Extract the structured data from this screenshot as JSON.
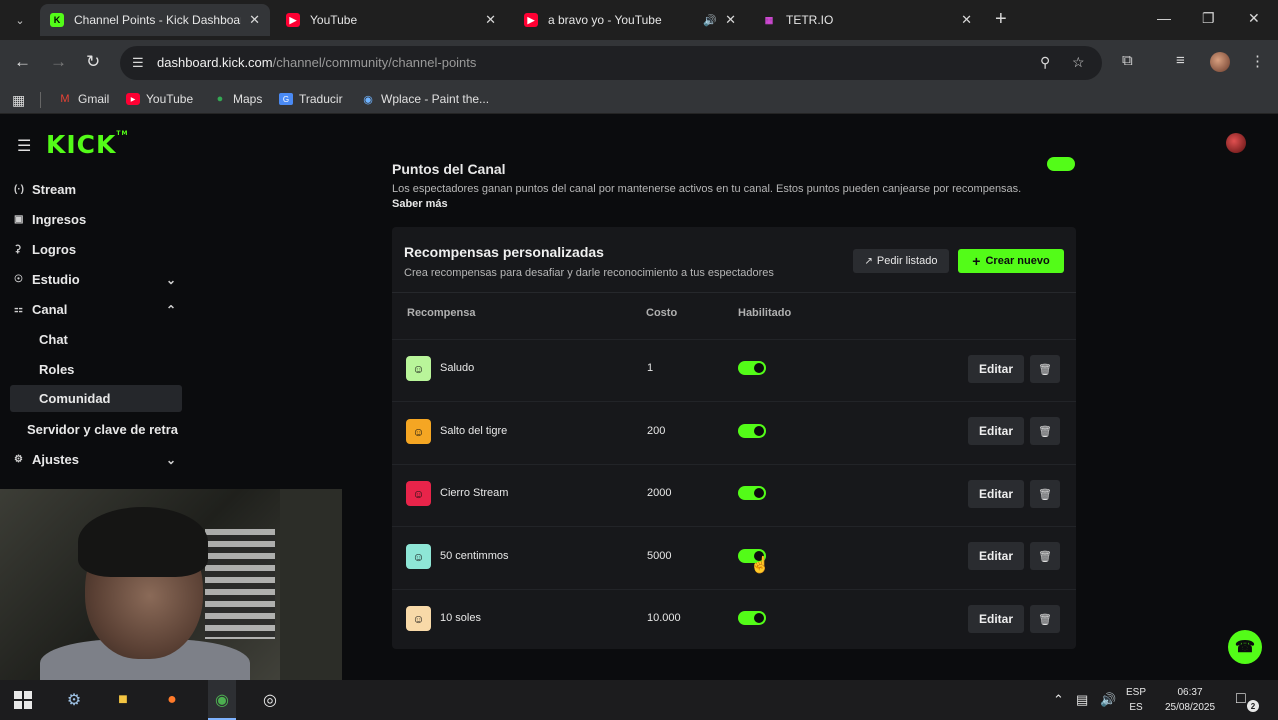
{
  "browser": {
    "tabs": [
      {
        "title": "Channel Points - Kick Dashboard",
        "favicon": "kick-icon",
        "active": true
      },
      {
        "title": "YouTube",
        "favicon": "youtube-icon",
        "active": false
      },
      {
        "title": "a bravo yo - YouTube",
        "favicon": "youtube-icon",
        "active": false,
        "audio": true
      },
      {
        "title": "TETR.IO",
        "favicon": "tetrio-icon",
        "active": false
      }
    ],
    "url_host": "dashboard.kick.com",
    "url_path": "/channel/community/channel-points",
    "bookmarks": [
      "Gmail",
      "YouTube",
      "Maps",
      "Traducir",
      "Wplace - Paint the..."
    ]
  },
  "sidebar": {
    "logo": "KICK",
    "logo_tm": "TM",
    "items": [
      {
        "label": "Stream",
        "icon": "broadcast-icon"
      },
      {
        "label": "Ingresos",
        "icon": "wallet-icon"
      },
      {
        "label": "Logros",
        "icon": "trophy-icon"
      },
      {
        "label": "Estudio",
        "icon": "palette-icon",
        "expandable": true,
        "expanded": false
      },
      {
        "label": "Canal",
        "icon": "channel-icon",
        "expandable": true,
        "expanded": true
      },
      {
        "label": "Ajustes",
        "icon": "gear-icon",
        "expandable": true,
        "expanded": false
      }
    ],
    "sub_items": [
      "Chat",
      "Roles",
      "Comunidad"
    ],
    "active_sub": "Comunidad",
    "extra_item": "Servidor y clave de retra"
  },
  "section": {
    "title": "Puntos del Canal",
    "description": "Los espectadores ganan puntos del canal por mantenerse activos en tu canal. Estos puntos pueden canjearse por recompensas.",
    "link": "Saber más",
    "enabled": true
  },
  "rewards": {
    "title": "Recompensas personalizadas",
    "subtitle": "Crea recompensas para desafiar y darle reconocimiento a tus espectadores",
    "request_button": "Pedir listado",
    "create_button": "Crear nuevo",
    "columns": {
      "reward": "Recompensa",
      "cost": "Costo",
      "enabled": "Habilitado"
    },
    "edit_label": "Editar",
    "rows": [
      {
        "name": "Saludo",
        "cost": "1",
        "enabled": true,
        "color": "#b9f59a"
      },
      {
        "name": "Salto del tigre",
        "cost": "200",
        "enabled": true,
        "color": "#f5a623"
      },
      {
        "name": "Cierro Stream",
        "cost": "2000",
        "enabled": true,
        "color": "#e8244a"
      },
      {
        "name": "50 centimmos",
        "cost": "5000",
        "enabled": true,
        "color": "#8ee6d6"
      },
      {
        "name": "10 soles",
        "cost": "10.000",
        "enabled": true,
        "color": "#f8d9a8"
      }
    ]
  },
  "taskbar": {
    "lang_top": "ESP",
    "lang_bottom": "ES",
    "time": "06:37",
    "date": "25/08/2025",
    "notifications": "2"
  },
  "colors": {
    "accent": "#53fc18",
    "background": "#0b0c0e",
    "card": "#17181b"
  }
}
